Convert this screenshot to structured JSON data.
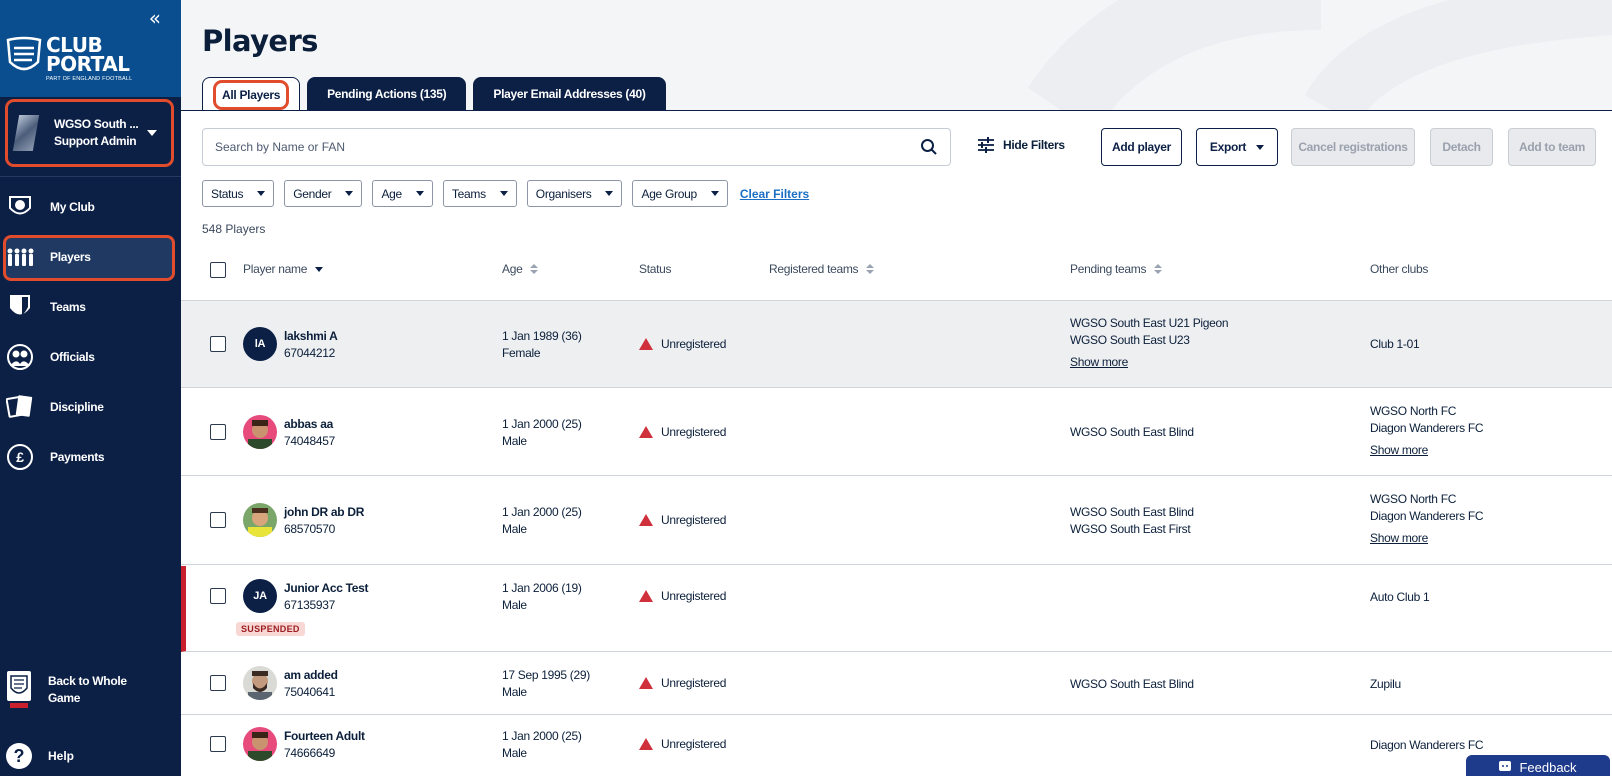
{
  "sidebar": {
    "logo": {
      "line1": "CLUB",
      "line2": "PORTAL",
      "sub": "PART OF ENGLAND FOOTBALL"
    },
    "club": {
      "name": "WGSO South ...",
      "role": "Support Admin"
    },
    "nav": [
      {
        "label": "My Club",
        "icon": "shield-ball-icon"
      },
      {
        "label": "Players",
        "icon": "players-group-icon"
      },
      {
        "label": "Teams",
        "icon": "team-shield-icon"
      },
      {
        "label": "Officials",
        "icon": "officials-icon"
      },
      {
        "label": "Discipline",
        "icon": "cards-icon"
      },
      {
        "label": "Payments",
        "icon": "pound-icon"
      }
    ],
    "back_label": "Back to Whole Game",
    "help_label": "Help"
  },
  "page": {
    "title": "Players"
  },
  "tabs": [
    {
      "label": "All Players",
      "active": true
    },
    {
      "label": "Pending Actions (135)",
      "active": false
    },
    {
      "label": "Player Email Addresses (40)",
      "active": false
    }
  ],
  "search": {
    "placeholder": "Search by Name or FAN"
  },
  "toolbar": {
    "hide_filters": "Hide Filters",
    "add_player": "Add player",
    "export": "Export",
    "cancel_registrations": "Cancel registrations",
    "detach": "Detach",
    "add_to_team": "Add to team"
  },
  "filters": [
    "Status",
    "Gender",
    "Age",
    "Teams",
    "Organisers",
    "Age Group"
  ],
  "clear_filters": "Clear Filters",
  "player_count": "548 Players",
  "columns": {
    "player_name": "Player name",
    "age": "Age",
    "status": "Status",
    "registered_teams": "Registered teams",
    "pending_teams": "Pending teams",
    "other_clubs": "Other clubs"
  },
  "rows": [
    {
      "name": "lakshmi A",
      "fan": "67044212",
      "initials": "lA",
      "dob": "1 Jan 1989 (36)",
      "gender": "Female",
      "status": "Unregistered",
      "pending": [
        "WGSO South East U21 Pigeon",
        "WGSO South East U23"
      ],
      "pending_more": "Show more",
      "other": [
        "Club 1-01"
      ],
      "other_more": ""
    },
    {
      "name": "abbas aa",
      "fan": "74048457",
      "initials": "",
      "dob": "1 Jan 2000 (25)",
      "gender": "Male",
      "status": "Unregistered",
      "pending": [
        "WGSO South East Blind"
      ],
      "pending_more": "",
      "other": [
        "WGSO North FC",
        "Diagon Wanderers FC"
      ],
      "other_more": "Show more"
    },
    {
      "name": "john DR ab DR",
      "fan": "68570570",
      "initials": "",
      "dob": "1 Jan 2000 (25)",
      "gender": "Male",
      "status": "Unregistered",
      "pending": [
        "WGSO South East Blind",
        "WGSO South East First"
      ],
      "pending_more": "",
      "other": [
        "WGSO North FC",
        "Diagon Wanderers FC"
      ],
      "other_more": "Show more"
    },
    {
      "name": "Junior Acc Test",
      "fan": "67135937",
      "initials": "JA",
      "badge": "SUSPENDED",
      "dob": "1 Jan 2006 (19)",
      "gender": "Male",
      "status": "Unregistered",
      "pending": [],
      "pending_more": "",
      "other": [
        "Auto Club 1"
      ],
      "other_more": ""
    },
    {
      "name": "am added",
      "fan": "75040641",
      "initials": "",
      "dob": "17 Sep 1995 (29)",
      "gender": "Male",
      "status": "Unregistered",
      "pending": [
        "WGSO South East Blind"
      ],
      "pending_more": "",
      "other": [
        "Zupilu"
      ],
      "other_more": ""
    },
    {
      "name": "Fourteen Adult",
      "fan": "74666649",
      "initials": "",
      "dob": "1 Jan 2000 (25)",
      "gender": "Male",
      "status": "Unregistered",
      "pending": [],
      "pending_more": "",
      "other": [
        "Diagon Wanderers FC"
      ],
      "other_more": ""
    }
  ],
  "feedback": "Feedback"
}
